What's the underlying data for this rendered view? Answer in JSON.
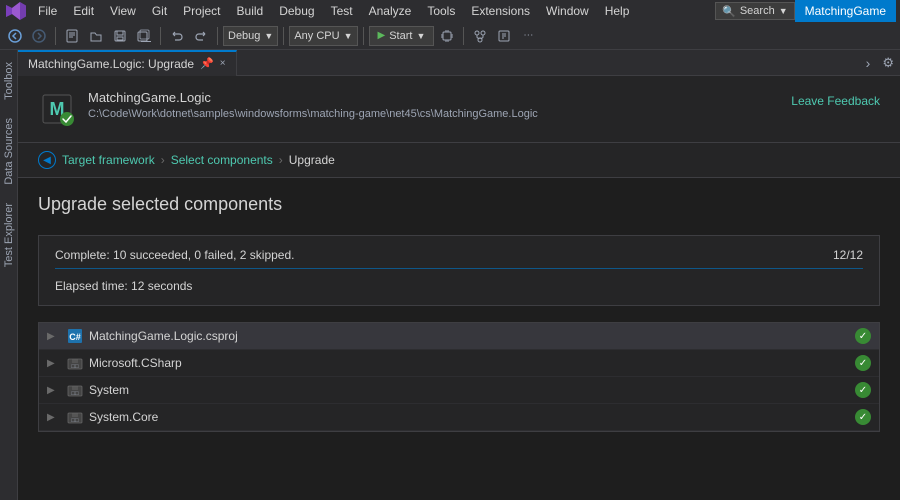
{
  "menubar": {
    "items": [
      "File",
      "Edit",
      "View",
      "Git",
      "Project",
      "Build",
      "Debug",
      "Test",
      "Analyze",
      "Tools",
      "Extensions",
      "Window",
      "Help"
    ],
    "search_text": "Search",
    "search_icon": "search-icon",
    "app_name": "MatchingGame"
  },
  "toolbar": {
    "debug_config": "Debug",
    "cpu_config": "Any CPU",
    "start_label": "Start"
  },
  "tab": {
    "title": "MatchingGame.Logic: Upgrade",
    "close_icon": "×",
    "pin_icon": "📌"
  },
  "header": {
    "project_name": "MatchingGame.Logic",
    "project_path": "C:\\Code\\Work\\dotnet\\samples\\windowsforms\\matching-game\\net45\\cs\\MatchingGame.Logic",
    "leave_feedback": "Leave Feedback"
  },
  "breadcrumb": {
    "items": [
      "Target framework",
      "Select components",
      "Upgrade"
    ],
    "back_icon": "◀"
  },
  "page": {
    "title": "Upgrade selected components",
    "status": "Complete: 10 succeeded, 0 failed, 2 skipped.",
    "progress": "12/12",
    "elapsed": "Elapsed time: 12 seconds"
  },
  "sidebar": {
    "tabs": [
      "Toolbox",
      "Data Sources",
      "Test Explorer"
    ]
  },
  "results": [
    {
      "name": "MatchingGame.Logic.csproj",
      "type": "project",
      "status": "success",
      "selected": true
    },
    {
      "name": "Microsoft.CSharp",
      "type": "package",
      "status": "success",
      "selected": false
    },
    {
      "name": "System",
      "type": "package",
      "status": "success",
      "selected": false
    },
    {
      "name": "System.Core",
      "type": "package",
      "status": "success",
      "selected": false
    }
  ]
}
